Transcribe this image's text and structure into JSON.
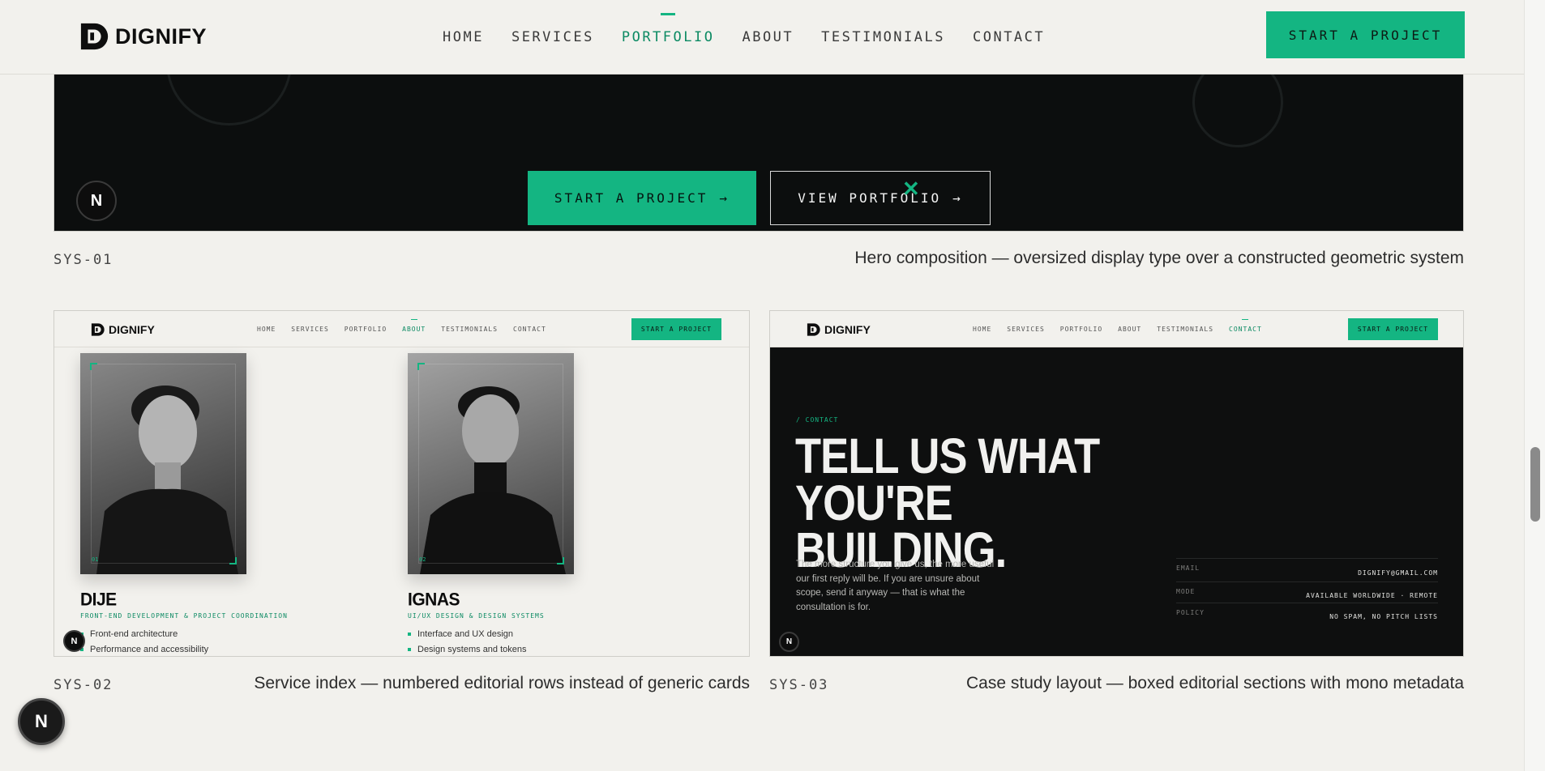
{
  "header": {
    "brand": "DIGNIFY",
    "nav": [
      "HOME",
      "SERVICES",
      "PORTFOLIO",
      "ABOUT",
      "TESTIMONIALS",
      "CONTACT"
    ],
    "active_nav": "PORTFOLIO",
    "cta": "START A PROJECT"
  },
  "hero_preview": {
    "primary_button": "START A PROJECT",
    "secondary_button": "VIEW PORTFOLIO",
    "arrow": "→",
    "badge": "N"
  },
  "captions": [
    {
      "code": "SYS-01",
      "text": "Hero composition — oversized display type over a constructed geometric system"
    },
    {
      "code": "SYS-02",
      "text": "Service index — numbered editorial rows instead of generic cards"
    },
    {
      "code": "SYS-03",
      "text": "Case study layout — boxed editorial sections with mono metadata"
    }
  ],
  "thumb_about": {
    "brand": "DIGNIFY",
    "nav": [
      "HOME",
      "SERVICES",
      "PORTFOLIO",
      "ABOUT",
      "TESTIMONIALS",
      "CONTACT"
    ],
    "active_nav": "ABOUT",
    "cta": "START A PROJECT",
    "members": [
      {
        "num": "01",
        "name": "DIJE",
        "role": "FRONT-END DEVELOPMENT & PROJECT COORDINATION",
        "bullets": [
          "Front-end architecture",
          "Performance and accessibility"
        ]
      },
      {
        "num": "02",
        "name": "IGNAS",
        "role": "UI/UX DESIGN & DESIGN SYSTEMS",
        "bullets": [
          "Interface and UX design",
          "Design systems and tokens"
        ]
      }
    ],
    "badge": "N"
  },
  "thumb_contact": {
    "brand": "DIGNIFY",
    "nav": [
      "HOME",
      "SERVICES",
      "PORTFOLIO",
      "ABOUT",
      "TESTIMONIALS",
      "CONTACT"
    ],
    "active_nav": "CONTACT",
    "cta": "START A PROJECT",
    "kicker": "/ CONTACT",
    "title_line1": "TELL US WHAT YOU'RE",
    "title_line2": "BUILDING.",
    "body": "The more structure you give us, the more useful our first reply will be. If you are unsure about scope, send it anyway — that is what the consultation is for.",
    "rows": [
      {
        "key": "EMAIL",
        "value": "DIGNIFY@GMAIL.COM"
      },
      {
        "key": "MODE",
        "value": "AVAILABLE WORLDWIDE · REMOTE"
      },
      {
        "key": "POLICY",
        "value": "NO SPAM, NO PITCH LISTS"
      }
    ],
    "badge": "N"
  },
  "floating_badge": "N",
  "colors": {
    "accent": "#14b582",
    "accent_text": "#0c8a63",
    "page_bg": "#f2f1ed",
    "dark": "#0c0e0e"
  }
}
